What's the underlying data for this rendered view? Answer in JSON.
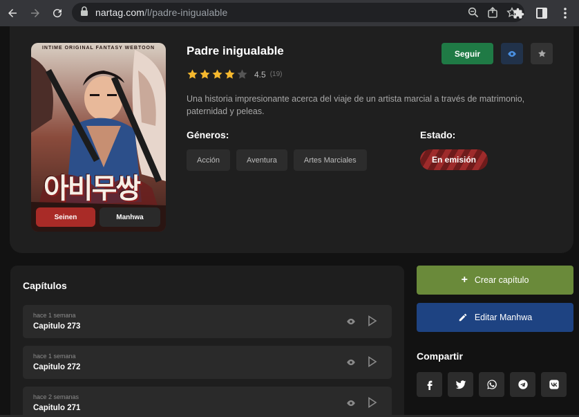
{
  "browser": {
    "url_host": "nartag.com",
    "url_path": "/l/padre-inigualable"
  },
  "manga": {
    "title": "Padre inigualable",
    "rating": "4.5",
    "votes": "(19)",
    "stars_filled": 4.5,
    "description": "Una historia impresionante acerca del viaje de un artista marcial a través de matrimonio, paternidad y peleas.",
    "cover_tagline": "INTIME ORIGINAL FANTASY WEBTOON",
    "cover_title": "아비무쌍",
    "cover_badges": [
      "Seinen",
      "Manhwa"
    ]
  },
  "actions": {
    "follow_label": "Seguir"
  },
  "genres": {
    "label": "Géneros:",
    "items": [
      "Acción",
      "Aventura",
      "Artes Marciales"
    ]
  },
  "status": {
    "label": "Estado:",
    "value": "En emisión"
  },
  "chapters": {
    "title": "Capítulos",
    "items": [
      {
        "time": "hace 1 semana",
        "name": "Capitulo 273"
      },
      {
        "time": "hace 1 semana",
        "name": "Capitulo 272"
      },
      {
        "time": "hace 2 semanas",
        "name": "Capitulo 271"
      }
    ]
  },
  "sidebar": {
    "create_label": "Crear capítulo",
    "edit_label": "Editar Manhwa",
    "share_title": "Compartir",
    "share_icons": [
      "facebook-icon",
      "twitter-icon",
      "whatsapp-icon",
      "telegram-icon",
      "vk-icon"
    ]
  },
  "colors": {
    "follow": "#1f7a45",
    "create": "#6a8a3a",
    "edit": "#1e4382",
    "status": "#9e2b2b",
    "star": "#f5b82e"
  }
}
